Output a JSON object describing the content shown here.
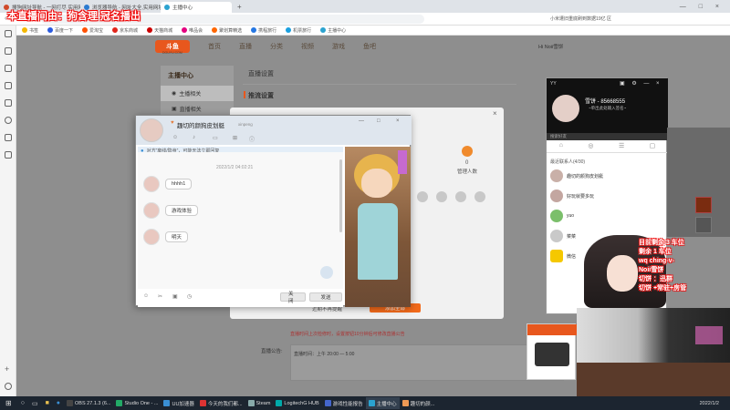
{
  "browser": {
    "tabs": [
      {
        "label": "搜狗网址导航 - 一网打尽 实用网址",
        "color": "#d04a2b",
        "active": false
      },
      {
        "label": "浏览器导航 - 网址大全,实用网址...",
        "color": "#2b7ad0",
        "active": false
      },
      {
        "label": "主播中心",
        "color": "#2ba3d0",
        "active": true
      }
    ],
    "new_tab": "+",
    "search_hint": "小米遭旧重底刷到数据19亿 区",
    "bookmarks": [
      "书签",
      "百度一下",
      "爱淘宝",
      "京东商城",
      "天猫商城",
      "唯品会",
      "聚划算精选",
      "携程旅行",
      "机票旅行",
      "主播中心"
    ]
  },
  "overlay_text": "本直播间由：狗含理 冠名播出",
  "site": {
    "logo": "斗鱼",
    "logo_sub": "DOUYU.COM",
    "nav": [
      "首页",
      "直播",
      "分类",
      "视频",
      "游戏",
      "鱼吧"
    ],
    "user": "Hi Noii雪饼",
    "left_menu_title": "主播中心",
    "left_menu_items": [
      "主播相关",
      "直播相关"
    ],
    "content_title": "直播设置",
    "sub_title": "推流设置",
    "lower_label": "直播公告:",
    "lower_text": "直播时间：上午 20:00 — 5:00",
    "lower_hint": "直播时间上次检修时，设置按钮10分钟后可修改直播公告"
  },
  "modal": {
    "close": "×",
    "stat_value": "0",
    "stat_label": "管理人数",
    "dont_remind": "近期不再提醒",
    "add_all": "添加全部"
  },
  "chat": {
    "title": "趣切的颜狗皮划艇",
    "subtitle": "xinpeng",
    "notice": "对方“离线/隐身”，可能无法立即回复",
    "timestamp": "2022/1/2 04:02:21",
    "messages": [
      "hhhh1",
      "游戏体验",
      "明天"
    ],
    "close_btn": "关闭",
    "send_btn": "发送",
    "window_controls": [
      "—",
      "□",
      "×"
    ]
  },
  "yy": {
    "app_label": "YY",
    "user_name": "雪饼 - 85668555",
    "user_status": "~单出此处输入签名~",
    "search_placeholder": "搜索好友",
    "group_label": "最近联系人(4/30)",
    "contacts": [
      {
        "name": "趣切的颜狗皮划艇",
        "msg": ""
      },
      {
        "name": "雪饼",
        "msg": "好玩就要多玩"
      },
      {
        "name": "yuo",
        "msg": ""
      },
      {
        "name": "菜菜",
        "msg": ""
      },
      {
        "name": "微信",
        "msg": ""
      }
    ]
  },
  "stream_overlay": {
    "lines": [
      "目前剩余 3 车位",
      "剩余 1 车位",
      "wq ching-v-",
      "Noii雪饼",
      "切饼 ：迅群",
      "切饼 +常驻+房管"
    ]
  },
  "taskbar": {
    "items": [
      {
        "label": "OBS 27.1.3 (6...",
        "color": "#444"
      },
      {
        "label": "Studio One - ...",
        "color": "#2a6"
      },
      {
        "label": "UU加速器",
        "color": "#3a8fd4"
      },
      {
        "label": "今天的我们都...",
        "color": "#d33"
      },
      {
        "label": "Steam",
        "color": "#1b2838"
      },
      {
        "label": "LogitechG HUB",
        "color": "#0aa"
      },
      {
        "label": "游戏性能报告",
        "color": "#46c"
      },
      {
        "label": "主播中心",
        "color": "#2ba3d0"
      },
      {
        "label": "趣切的颜...",
        "color": "#e95"
      }
    ],
    "clock": "2022/1/2"
  }
}
